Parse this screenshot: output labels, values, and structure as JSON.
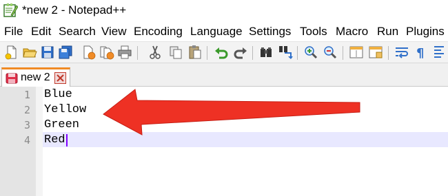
{
  "window": {
    "title": "*new 2 - Notepad++"
  },
  "menu": [
    "File",
    "Edit",
    "Search",
    "View",
    "Encoding",
    "Language",
    "Settings",
    "Tools",
    "Macro",
    "Run",
    "Plugins"
  ],
  "toolbar_icons": [
    "new-file-icon",
    "open-file-icon",
    "save-icon",
    "save-all-icon",
    "close-icon",
    "close-all-icon",
    "print-icon",
    "cut-icon",
    "copy-icon",
    "paste-icon",
    "undo-icon",
    "redo-icon",
    "find-icon",
    "replace-icon",
    "zoom-in-icon",
    "zoom-out-icon",
    "sync-vertical-icon",
    "sync-horizontal-icon",
    "word-wrap-icon",
    "show-all-chars-icon",
    "indent-guide-icon"
  ],
  "tabs": [
    {
      "label": "new 2",
      "active": true,
      "modified": true
    }
  ],
  "editor": {
    "lines": [
      {
        "number": "1",
        "text": "Blue"
      },
      {
        "number": "2",
        "text": "Yellow"
      },
      {
        "number": "3",
        "text": "Green"
      },
      {
        "number": "4",
        "text": "Red"
      }
    ],
    "current_line": 4
  },
  "colors": {
    "arrow": "#ee3124",
    "tab_accent": "#f08a24",
    "current_line": "#e8e8ff",
    "caret": "#8000ff"
  }
}
